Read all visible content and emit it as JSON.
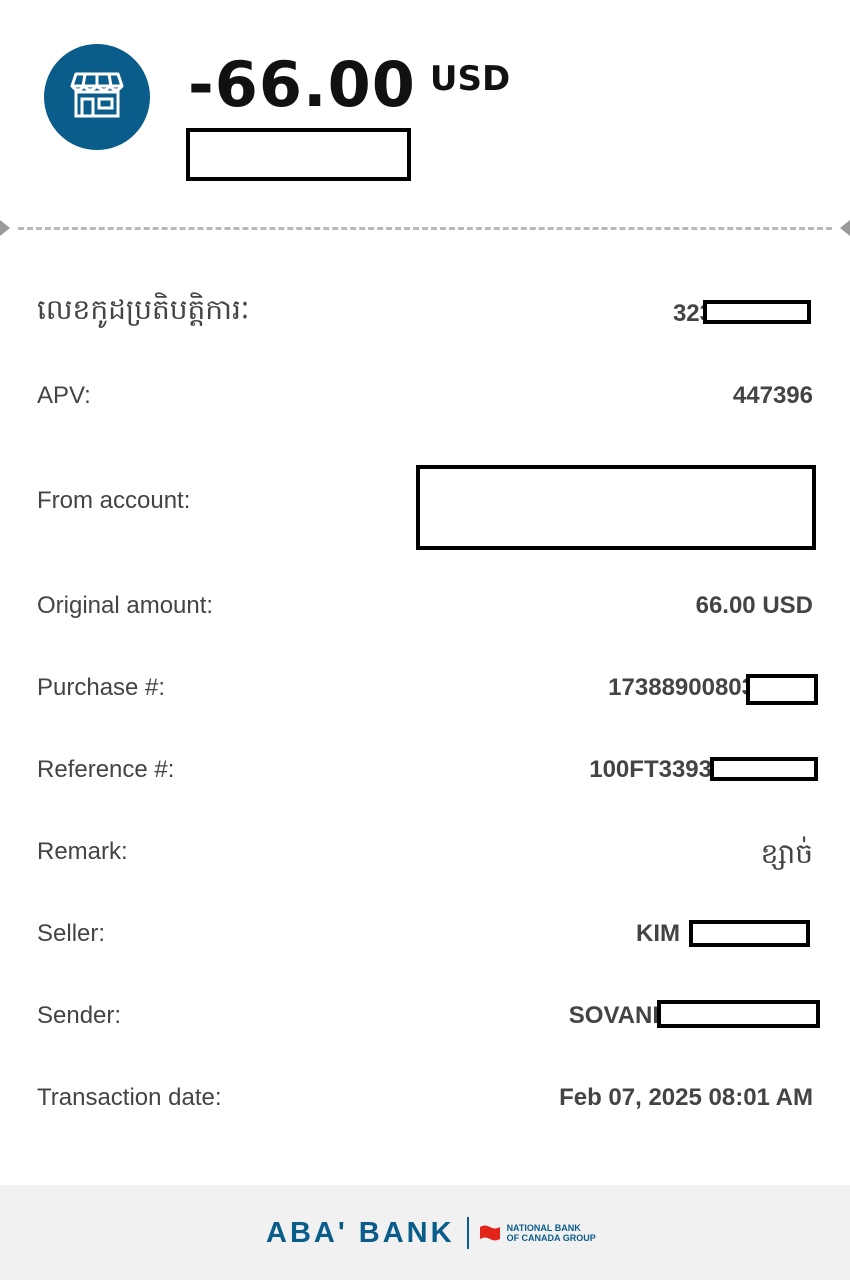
{
  "header": {
    "amount": "-66.00",
    "currency": "USD",
    "merchant_icon": "storefront-icon"
  },
  "details": {
    "transaction_id_label": "លេខកូដប្រតិបត្តិការៈ",
    "transaction_id_value": "323",
    "apv_label": "APV:",
    "apv_value": "447396",
    "from_account_label": "From account:",
    "original_amount_label": "Original amount:",
    "original_amount_value": "66.00 USD",
    "purchase_label": "Purchase #:",
    "purchase_value": "17388900803",
    "reference_label": "Reference #:",
    "reference_value": "100FT3393",
    "remark_label": "Remark:",
    "remark_value": "ខ្សាច់",
    "seller_label": "Seller:",
    "seller_value": "KIM",
    "sender_label": "Sender:",
    "sender_value": "SOVANI",
    "date_label": "Transaction date:",
    "date_value": "Feb 07, 2025 08:01 AM"
  },
  "footer": {
    "brand_name": "ABA' BANK",
    "group_line1": "NATIONAL BANK",
    "group_line2": "OF CANADA GROUP"
  },
  "colors": {
    "brand_blue": "#0a5c8a",
    "flag_red": "#e1251b",
    "text": "#444444"
  }
}
